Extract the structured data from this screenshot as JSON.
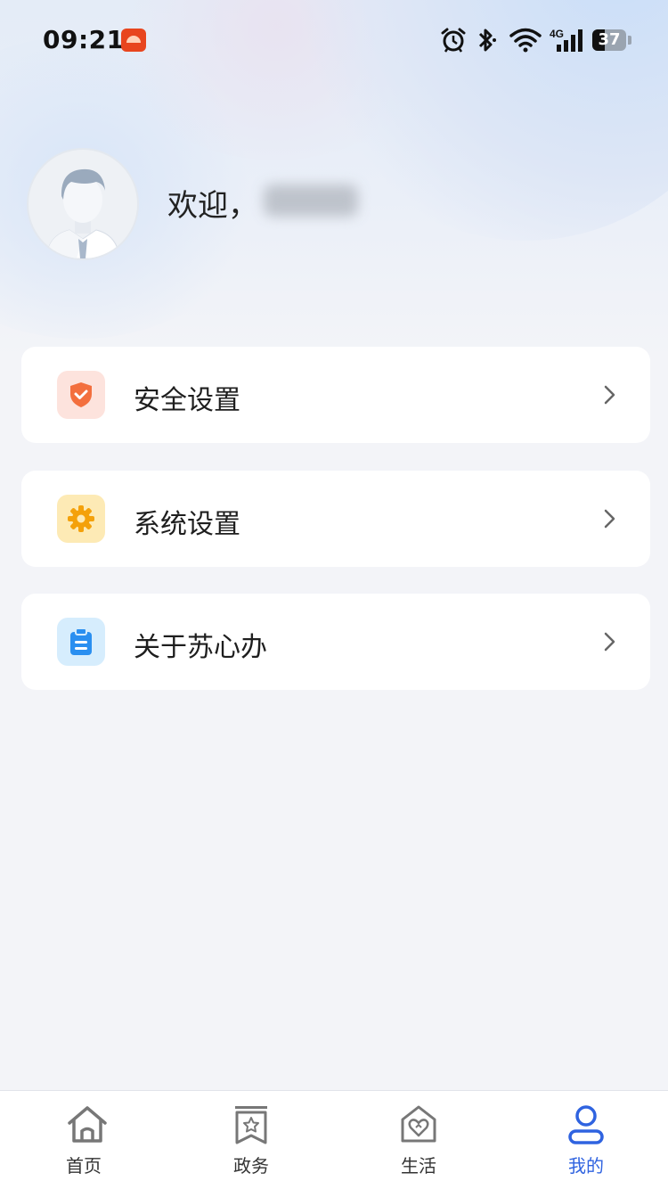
{
  "status_bar": {
    "time": "09:21",
    "network": "4G",
    "battery": "37",
    "battery_level": 0.37
  },
  "profile": {
    "greeting": "欢迎，",
    "username_blurred": true
  },
  "menu": [
    {
      "label": "安全设置",
      "icon": "shield-icon",
      "icon_bg": "#fde3dd",
      "icon_color": "#f36f3e"
    },
    {
      "label": "系统设置",
      "icon": "gear-icon",
      "icon_bg": "#fdeab5",
      "icon_color": "#f4a10b"
    },
    {
      "label": "关于苏心办",
      "icon": "clipboard-icon",
      "icon_bg": "#d6edfd",
      "icon_color": "#2a8ff0"
    }
  ],
  "tabs": [
    {
      "label": "首页",
      "icon": "home-icon",
      "active": false
    },
    {
      "label": "政务",
      "icon": "bookmark-star-icon",
      "active": false
    },
    {
      "label": "生活",
      "icon": "heart-house-icon",
      "active": false
    },
    {
      "label": "我的",
      "icon": "user-icon",
      "active": true
    }
  ],
  "colors": {
    "accent": "#2f63e0",
    "background": "#f3f4f8",
    "card": "#ffffff"
  }
}
